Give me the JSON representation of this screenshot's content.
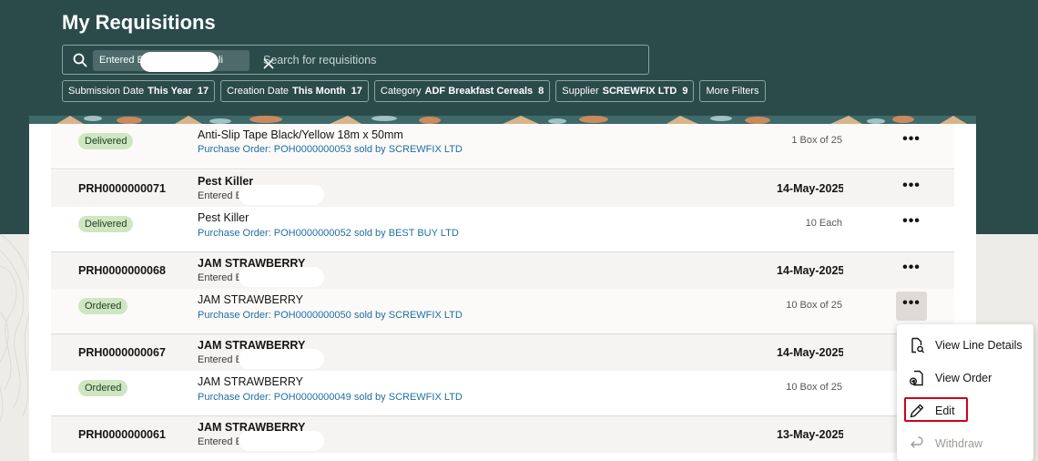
{
  "page": {
    "title": "My Requisitions"
  },
  "search": {
    "chip_prefix": "Entered B",
    "chip_suffix": "li",
    "placeholder": "Search for requisitions"
  },
  "filters": [
    {
      "label": "Submission Date",
      "value": "This Year",
      "count": "17"
    },
    {
      "label": "Creation Date",
      "value": "This Month",
      "count": "17"
    },
    {
      "label": "Category",
      "value": "ADF Breakfast Cereals",
      "count": "8"
    },
    {
      "label": "Supplier",
      "value": "SCREWFIX LTD",
      "count": "9"
    },
    {
      "label": "More Filters",
      "value": "",
      "count": ""
    }
  ],
  "requisitions": [
    {
      "number": "",
      "title": "",
      "entered_by": "",
      "date": "",
      "line": {
        "status": "Delivered",
        "title": "Anti-Slip Tape Black/Yellow 18m x 50mm",
        "po": "Purchase Order: POH0000000053 sold by SCREWFIX LTD",
        "qty": "1 Box of 25"
      }
    },
    {
      "number": "PRH0000000071",
      "title": "Pest Killer",
      "entered_by": "Entered B",
      "date": "14-May-2025",
      "line": {
        "status": "Delivered",
        "title": "Pest Killer",
        "po": "Purchase Order: POH0000000052 sold by BEST BUY LTD",
        "qty": "10 Each"
      }
    },
    {
      "number": "PRH0000000068",
      "title": "JAM STRAWBERRY",
      "entered_by": "Entered B",
      "date": "14-May-2025",
      "line": {
        "status": "Ordered",
        "title": "JAM STRAWBERRY",
        "po": "Purchase Order: POH0000000050 sold by SCREWFIX LTD",
        "qty": "10 Box of 25"
      }
    },
    {
      "number": "PRH0000000067",
      "title": "JAM STRAWBERRY",
      "entered_by": "Entered B",
      "date": "14-May-2025",
      "line": {
        "status": "Ordered",
        "title": "JAM STRAWBERRY",
        "po": "Purchase Order: POH0000000049 sold by SCREWFIX LTD",
        "qty": "10 Box of 25"
      }
    },
    {
      "number": "PRH0000000061",
      "title": "JAM STRAWBERRY",
      "entered_by": "Entered E",
      "date": "13-May-2025",
      "line": null
    }
  ],
  "more_actions_label": "•••",
  "menu": {
    "items": [
      {
        "label": "View Line Details",
        "icon": "document-search-icon",
        "enabled": true
      },
      {
        "label": "View Order",
        "icon": "document-arrow-icon",
        "enabled": true
      },
      {
        "label": "Edit",
        "icon": "pencil-icon",
        "enabled": true
      },
      {
        "label": "Withdraw",
        "icon": "undo-icon",
        "enabled": false
      }
    ]
  },
  "colors": {
    "header_bg": "#2b4b4b",
    "link": "#1e6fa3",
    "badge_bg": "#cfe6c2",
    "highlight": "#d0021b"
  }
}
